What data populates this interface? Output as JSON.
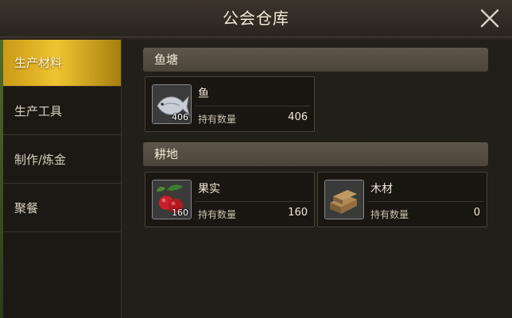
{
  "header": {
    "title": "公会仓库"
  },
  "sidebar": {
    "tabs": [
      {
        "label": "生产材料",
        "active": true
      },
      {
        "label": "生产工具",
        "active": false
      },
      {
        "label": "制作/炼金",
        "active": false
      },
      {
        "label": "聚餐",
        "active": false
      }
    ]
  },
  "sections": [
    {
      "title": "鱼塘",
      "items": [
        {
          "name": "鱼",
          "icon": "fish-icon",
          "icon_count": "406",
          "qty_label": "持有数量",
          "qty": "406"
        }
      ]
    },
    {
      "title": "耕地",
      "items": [
        {
          "name": "果实",
          "icon": "fruit-icon",
          "icon_count": "160",
          "qty_label": "持有数量",
          "qty": "160"
        },
        {
          "name": "木材",
          "icon": "wood-icon",
          "icon_count": "",
          "qty_label": "持有数量",
          "qty": "0"
        }
      ]
    }
  ],
  "colors": {
    "active_tab": "#f0c430",
    "section_bar": "#5d564a"
  }
}
